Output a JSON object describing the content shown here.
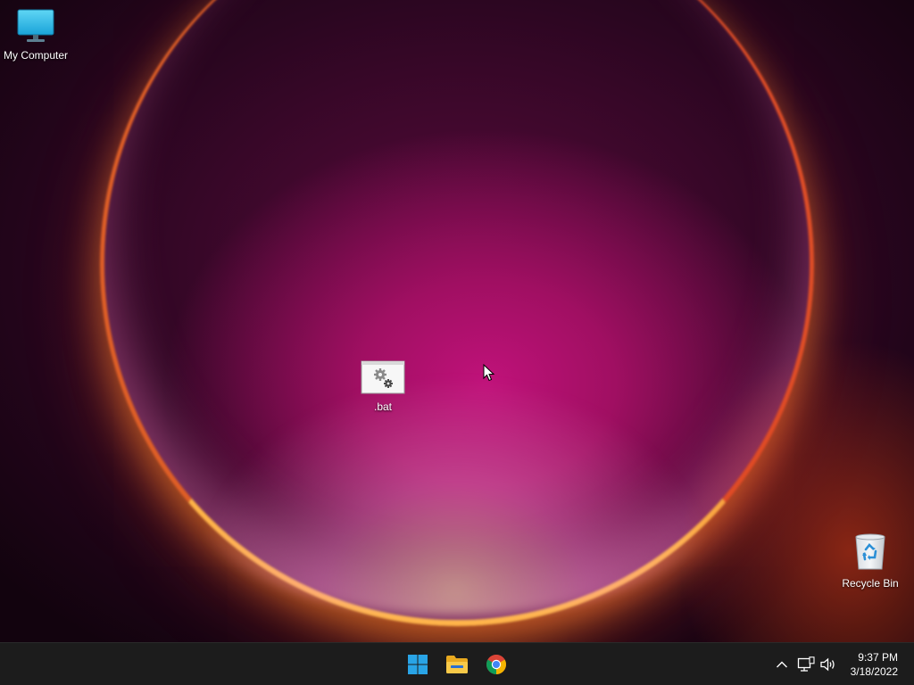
{
  "desktop": {
    "icons": {
      "my_computer": {
        "label": "My Computer",
        "icon": "monitor-icon"
      },
      "bat_file": {
        "label": ".bat",
        "icon": "batch-file-gears-icon"
      },
      "recycle_bin": {
        "label": "Recycle Bin",
        "icon": "recycle-bin-icon"
      }
    }
  },
  "taskbar": {
    "pinned": [
      {
        "name": "Start",
        "icon": "windows-logo-icon"
      },
      {
        "name": "File Explorer",
        "icon": "folder-icon"
      },
      {
        "name": "Google Chrome",
        "icon": "chrome-icon"
      }
    ],
    "tray": {
      "icons": [
        "chevron-up-icon",
        "network-icon",
        "volume-icon"
      ]
    },
    "clock": {
      "time": "9:37 PM",
      "date": "3/18/2022"
    }
  },
  "colors": {
    "taskbar_bg": "#1c1c1c",
    "windows_blue": "#29a4e6",
    "folder_yellow": "#f2c12e"
  }
}
